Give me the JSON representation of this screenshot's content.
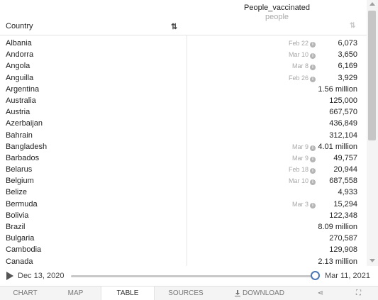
{
  "header": {
    "country_label": "Country",
    "country_sort_icon": "sort-alpha-icon",
    "country_sort_glyph": "⇅",
    "metric_title": "People_vaccinated",
    "metric_unit": "people",
    "metric_sort_icon": "sort-descending-icon",
    "metric_sort_glyph": "⇅"
  },
  "rows": [
    {
      "country": "Albania",
      "date": "Feb 22",
      "value": "6,073"
    },
    {
      "country": "Andorra",
      "date": "Mar 10",
      "value": "3,650"
    },
    {
      "country": "Angola",
      "date": "Mar 8",
      "value": "6,169"
    },
    {
      "country": "Anguilla",
      "date": "Feb 26",
      "value": "3,929"
    },
    {
      "country": "Argentina",
      "date": "",
      "value": "1.56 million"
    },
    {
      "country": "Australia",
      "date": "",
      "value": "125,000"
    },
    {
      "country": "Austria",
      "date": "",
      "value": "667,570"
    },
    {
      "country": "Azerbaijan",
      "date": "",
      "value": "436,849"
    },
    {
      "country": "Bahrain",
      "date": "",
      "value": "312,104"
    },
    {
      "country": "Bangladesh",
      "date": "Mar 9",
      "value": "4.01 million"
    },
    {
      "country": "Barbados",
      "date": "Mar 9",
      "value": "49,757"
    },
    {
      "country": "Belarus",
      "date": "Feb 18",
      "value": "20,944"
    },
    {
      "country": "Belgium",
      "date": "Mar 10",
      "value": "687,558"
    },
    {
      "country": "Belize",
      "date": "",
      "value": "4,933"
    },
    {
      "country": "Bermuda",
      "date": "Mar 3",
      "value": "15,294"
    },
    {
      "country": "Bolivia",
      "date": "",
      "value": "122,348"
    },
    {
      "country": "Brazil",
      "date": "",
      "value": "8.09 million"
    },
    {
      "country": "Bulgaria",
      "date": "",
      "value": "270,587"
    },
    {
      "country": "Cambodia",
      "date": "",
      "value": "129,908"
    },
    {
      "country": "Canada",
      "date": "",
      "value": "2.13 million"
    }
  ],
  "info_icon_glyph": "i",
  "timeline": {
    "play_icon": "play-icon",
    "start_date": "Dec 13, 2020",
    "end_date": "Mar 11, 2021",
    "position_fraction": 1.0
  },
  "tabs": {
    "chart": "CHART",
    "map": "MAP",
    "table": "TABLE",
    "sources": "SOURCES",
    "download": "DOWNLOAD",
    "share_glyph": "⋖",
    "fullscreen_glyph": "⛶"
  },
  "colors": {
    "slider_handle": "#4a78b5",
    "muted_text": "#a8a8a8"
  }
}
